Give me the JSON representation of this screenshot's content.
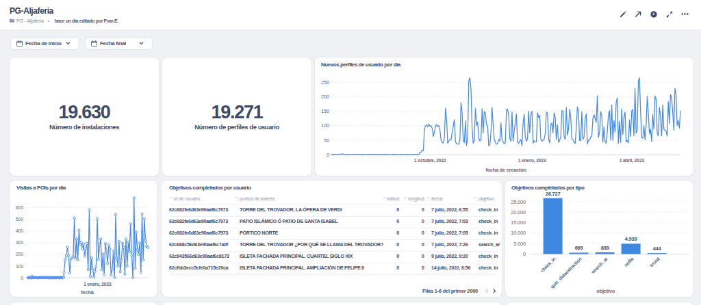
{
  "header": {
    "title": "PG-Aljaferia",
    "breadcrumb": "PG - Aljaferia",
    "separator": "•",
    "edited_info": "hace un día editado por Fran E.",
    "toolbar_icons": [
      "edit-pencil",
      "share-arrow",
      "data-freshness-clock",
      "fullscreen-expand",
      "more-options"
    ]
  },
  "filters": {
    "start_date_label": "Fecha de inicio",
    "end_date_label": "Fecha final"
  },
  "scorecards": [
    {
      "value": "19.630",
      "label": "Número de instalaciones"
    },
    {
      "value": "19.271",
      "label": "Número de perfiles de usuario"
    }
  ],
  "table": {
    "title": "Objetivos completados por usuario",
    "columns": [
      {
        "label": "id de usuario",
        "align": "left"
      },
      {
        "label": "puntos de interés",
        "align": "left"
      },
      {
        "label": "latitud",
        "align": "right"
      },
      {
        "label": "longitud",
        "align": "right"
      },
      {
        "label": "fecha",
        "align": "left"
      },
      {
        "label": "objetivo",
        "align": "left"
      }
    ],
    "rows": [
      [
        "62c682fe6d63e90aaf6c7973",
        "TORRE DEL TROVADOR. LA ÓPERA DE VERDI",
        "0",
        "0",
        "7 julio, 2022, 6:55",
        "check_in"
      ],
      [
        "62c682fe6d63e90aaf6c7973",
        "PATIO ISLÁMICO Ó PATIO DE SANTA ISABEL",
        "0",
        "0",
        "7 julio, 2022, 7:03",
        "check_in"
      ],
      [
        "62c682fe6d63e90aaf6c7973",
        "PÓRTICO NORTE",
        "0",
        "0",
        "7 julio, 2022, 7:05",
        "check_in"
      ],
      [
        "62c688c56d63e90aaf6c7a0f",
        "TORRE DEL TROVADOR ¿POR QUÉ SE LLAMA DEL TROVADOR?",
        "0",
        "0",
        "7 julio, 2022, 7:26",
        "search_ar"
      ],
      [
        "62c943566d63e90aaf6c8173",
        "ISLETA FACHADA PRINCIPAL. CUARTEL SIGLO XIX",
        "0",
        "0",
        "9 julio, 2022, 9:20",
        "check_in"
      ],
      [
        "62cfbb3ecc5cfe0a715e20ca",
        "ISLETA FACHADA PRINCIPAL. AMPLIACIÓN DE FELIPE II",
        "0",
        "0",
        "14 julio, 2022, 6:56",
        "check_in"
      ]
    ],
    "pagination": {
      "text": "Filas 1-6 del primer 2000",
      "prev_icon": "chevron-left",
      "next_icon": "chevron-right"
    }
  },
  "colors": {
    "accent_blue_line": "#4285f4",
    "accent_blue_bar": "#3f88e0",
    "text_navy": "#3f4b66",
    "text_gray": "#707d96",
    "background": "#eff1f5"
  },
  "chart_data": [
    {
      "id": "perfiles",
      "type": "line",
      "title": "Nuevos perfiles de usuario por día",
      "xlabel": "fecha de creación",
      "ylabel": "",
      "x_start_date": "2022-07-04",
      "x_days_total": 315,
      "ylim": [
        0,
        265
      ],
      "yticks": [
        0,
        50,
        100,
        150,
        200,
        250
      ],
      "xticks": [
        {
          "label": "1 octubre, 2022",
          "day": 89
        },
        {
          "label": "1 enero, 2023",
          "day": 181
        },
        {
          "label": "1 abril, 2023",
          "day": 271
        }
      ],
      "markers": false,
      "values": [
        1,
        2,
        1,
        2,
        1,
        1,
        1,
        2,
        2,
        2,
        5,
        1,
        1,
        1,
        1,
        2,
        2,
        1,
        1,
        1,
        2,
        2,
        2,
        1,
        2,
        2,
        2,
        1,
        2,
        1,
        1,
        1,
        1,
        2,
        2,
        2,
        2,
        1,
        2,
        1,
        2,
        1,
        2,
        1,
        2,
        2,
        2,
        1,
        2,
        1,
        2,
        1,
        1,
        1,
        1,
        2,
        1,
        2,
        1,
        2,
        1,
        1,
        2,
        2,
        2,
        1,
        1,
        2,
        1,
        2,
        1,
        1,
        2,
        1,
        2,
        1,
        2,
        1,
        2,
        1,
        8,
        9,
        16,
        14,
        88,
        100,
        103,
        96,
        106,
        98,
        100,
        92,
        63,
        78,
        100,
        104,
        97,
        101,
        85,
        50,
        42,
        41,
        59,
        160,
        124,
        39,
        48,
        52,
        52,
        76,
        99,
        121,
        45,
        39,
        37,
        37,
        51,
        180,
        146,
        50,
        42,
        117,
        32,
        58,
        253,
        265,
        228,
        95,
        40,
        48,
        160,
        102,
        113,
        58,
        48,
        51,
        158,
        75,
        149,
        144,
        103,
        100,
        31,
        35,
        75,
        163,
        105,
        54,
        43,
        37,
        38,
        53,
        48,
        110,
        54,
        44,
        38,
        43,
        155,
        157,
        137,
        58,
        47,
        148,
        47,
        83,
        111,
        140,
        44,
        39,
        48,
        53,
        32,
        110,
        140,
        61,
        47,
        55,
        150,
        76,
        139,
        150,
        40,
        49,
        44,
        44,
        145,
        128,
        135,
        55,
        47,
        51,
        53,
        75,
        147,
        144,
        55,
        41,
        104,
        110,
        76,
        145,
        129,
        53,
        103,
        43,
        51,
        60,
        152,
        152,
        63,
        53,
        163,
        68,
        87,
        157,
        129,
        55,
        53,
        43,
        39,
        92,
        165,
        149,
        50,
        49,
        148,
        54,
        61,
        123,
        141,
        37,
        51,
        51,
        61,
        64,
        125,
        138,
        125,
        112,
        203,
        60,
        78,
        149,
        135,
        44,
        96,
        46,
        40,
        80,
        138,
        152,
        51,
        172,
        50,
        118,
        79,
        181,
        196,
        40,
        116,
        43,
        158,
        70,
        128,
        147,
        44,
        50,
        41,
        120,
        63,
        151,
        156,
        65,
        228,
        74,
        85,
        252,
        265,
        151,
        60,
        57,
        100,
        52,
        100,
        201,
        143,
        73,
        88,
        46,
        138,
        88,
        202,
        192,
        74,
        65,
        163,
        134,
        66,
        172,
        88,
        85,
        82,
        64,
        183,
        108,
        207,
        197,
        148,
        85,
        228,
        210,
        101,
        118,
        92,
        152
      ]
    },
    {
      "id": "visitas",
      "type": "line",
      "title": "Visitas a POIs por día",
      "xlabel": "fecha",
      "ylabel": "",
      "x_start_date": "2022-07-04",
      "x_days_total": 315,
      "ylim": [
        0,
        690
      ],
      "yticks": [
        0,
        100,
        200,
        300,
        400,
        500,
        600
      ],
      "xticks": [
        {
          "label": "1 enero, 2023",
          "day": 181
        }
      ],
      "markers": true,
      "x": [
        0,
        1,
        2,
        3,
        4,
        5,
        6,
        7,
        8,
        9,
        10,
        11,
        12,
        13,
        14,
        15,
        16,
        17,
        18,
        19,
        20,
        21,
        22,
        23,
        24,
        25,
        26,
        27,
        28,
        29,
        30,
        31,
        32,
        33,
        34,
        35,
        36,
        37,
        38,
        39,
        40,
        41,
        42,
        43,
        44,
        45,
        46,
        47,
        48,
        49,
        50,
        51,
        52,
        53,
        54,
        55,
        56,
        57,
        58,
        59,
        60,
        61,
        62,
        63,
        64,
        65,
        66,
        67,
        68,
        69,
        70,
        71,
        72,
        73,
        74,
        75,
        76,
        77,
        78,
        79,
        80,
        81,
        82,
        83,
        84,
        85,
        86,
        87,
        88,
        89,
        90,
        91,
        92,
        93,
        94,
        97,
        100,
        103,
        106,
        109,
        112,
        115,
        118,
        121,
        124,
        127,
        130,
        133,
        136,
        139,
        142,
        145,
        148,
        151,
        154,
        157,
        160,
        163,
        166,
        169,
        172,
        175,
        178,
        181,
        184,
        187,
        190,
        193,
        196,
        199,
        202,
        205,
        208,
        211,
        214,
        217,
        220,
        223,
        226,
        229,
        232,
        235,
        238,
        241,
        244,
        247,
        250,
        253,
        256,
        259,
        262,
        265,
        268,
        271,
        274,
        277,
        280,
        283,
        286,
        289,
        292,
        295,
        298,
        301,
        304,
        307,
        310,
        313
      ],
      "values": [
        2,
        1,
        2,
        1,
        1,
        0,
        1,
        2,
        1,
        0,
        15,
        1,
        3,
        3,
        1,
        2,
        2,
        2,
        2,
        3,
        2,
        1,
        3,
        1,
        1,
        0,
        1,
        3,
        2,
        2,
        3,
        2,
        1,
        1,
        3,
        2,
        3,
        3,
        3,
        1,
        3,
        3,
        2,
        2,
        1,
        2,
        3,
        3,
        2,
        3,
        3,
        1,
        2,
        3,
        0,
        1,
        3,
        1,
        1,
        3,
        3,
        0,
        0,
        2,
        1,
        1,
        1,
        1,
        2,
        1,
        1,
        3,
        2,
        1,
        1,
        1,
        2,
        2,
        3,
        1,
        1,
        2,
        1,
        0,
        0,
        3,
        2,
        1,
        2,
        1,
        0,
        1,
        2,
        2,
        45,
        156,
        189,
        262,
        190,
        42,
        160,
        170,
        182,
        510,
        166,
        330,
        151,
        405,
        287,
        300,
        252,
        289,
        185,
        250,
        294,
        72,
        580,
        13,
        170,
        76,
        6,
        56,
        98,
        505,
        157,
        278,
        330,
        68,
        203,
        28,
        291,
        230,
        123,
        281,
        245,
        25,
        75,
        225,
        3,
        540,
        165,
        102,
        310,
        53,
        149,
        295,
        261,
        32,
        330,
        101,
        305,
        223,
        460,
        191,
        1,
        680,
        81,
        390,
        237,
        200,
        295,
        47,
        545,
        153,
        505,
        320,
        267,
        260
      ]
    },
    {
      "id": "objetivos",
      "type": "bar",
      "title": "Objetivos completados por tipo",
      "xlabel": "objetivo",
      "ylabel": "",
      "categories": [
        "check_in",
        "quiz_dataextraction",
        "search_ar",
        "selfie",
        "trivial"
      ],
      "values": [
        26727,
        669,
        838,
        4939,
        444
      ],
      "value_labels": [
        "26.727",
        "669",
        "838",
        "4.939",
        "444"
      ],
      "ylim": [
        0,
        27500
      ],
      "yticks": [
        0,
        5000,
        10000,
        15000,
        20000,
        25000
      ],
      "ytick_labels": [
        "0",
        "5.000",
        "10.000",
        "15.000",
        "20.000",
        "25.000"
      ]
    }
  ]
}
